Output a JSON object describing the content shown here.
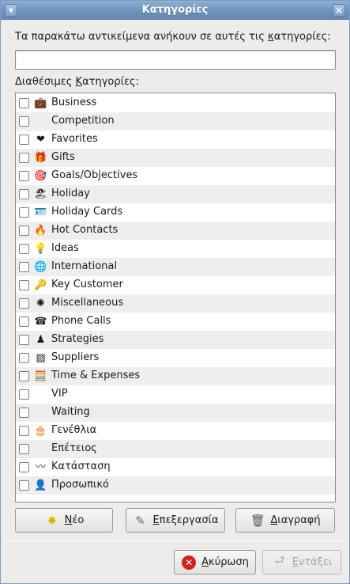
{
  "window": {
    "title": "Κατηγορίες"
  },
  "prompt": {
    "prefix": "Τα παρακάτω αντικείμενα ανήκουν σε αυτές τις ",
    "underlined": "κ",
    "suffix": "ατηγορίες:"
  },
  "entry": {
    "value": ""
  },
  "available": {
    "prefix": "Διαθέσιμες ",
    "underlined": "Κ",
    "suffix": "ατηγορίες:"
  },
  "categories": [
    {
      "label": "Business",
      "icon": "briefcase-icon",
      "glyph": "💼",
      "checked": false
    },
    {
      "label": "Competition",
      "icon": "",
      "glyph": "",
      "checked": false
    },
    {
      "label": "Favorites",
      "icon": "heart-icon",
      "glyph": "❤",
      "checked": false
    },
    {
      "label": "Gifts",
      "icon": "gift-icon",
      "glyph": "🎁",
      "checked": false
    },
    {
      "label": "Goals/Objectives",
      "icon": "target-icon",
      "glyph": "🎯",
      "checked": false
    },
    {
      "label": "Holiday",
      "icon": "holiday-icon",
      "glyph": "🏖",
      "checked": false
    },
    {
      "label": "Holiday Cards",
      "icon": "card-icon",
      "glyph": "🪪",
      "checked": false
    },
    {
      "label": "Hot Contacts",
      "icon": "flame-icon",
      "glyph": "🔥",
      "checked": false
    },
    {
      "label": "Ideas",
      "icon": "lightbulb-icon",
      "glyph": "💡",
      "checked": false
    },
    {
      "label": "International",
      "icon": "globe-icon",
      "glyph": "🌐",
      "checked": false
    },
    {
      "label": "Key Customer",
      "icon": "key-icon",
      "glyph": "🔑",
      "checked": false
    },
    {
      "label": "Miscellaneous",
      "icon": "sun-icon",
      "glyph": "✺",
      "checked": false
    },
    {
      "label": "Phone Calls",
      "icon": "telephone-icon",
      "glyph": "☎",
      "checked": false
    },
    {
      "label": "Strategies",
      "icon": "chess-piece-icon",
      "glyph": "♟",
      "checked": false
    },
    {
      "label": "Suppliers",
      "icon": "crate-icon",
      "glyph": "▨",
      "checked": false
    },
    {
      "label": "Time & Expenses",
      "icon": "calculator-icon",
      "glyph": "🧮",
      "checked": false
    },
    {
      "label": "VIP",
      "icon": "",
      "glyph": "",
      "checked": false
    },
    {
      "label": "Waiting",
      "icon": "",
      "glyph": "",
      "checked": false
    },
    {
      "label": "Γενέθλια",
      "icon": "cake-icon",
      "glyph": "🎂",
      "checked": false
    },
    {
      "label": "Επέτειος",
      "icon": "",
      "glyph": "",
      "checked": false
    },
    {
      "label": "Κατάσταση",
      "icon": "pulse-icon",
      "glyph": "〰",
      "checked": false
    },
    {
      "label": "Προσωπικό",
      "icon": "person-icon",
      "glyph": "👤",
      "checked": false
    }
  ],
  "buttons": {
    "new": {
      "underlined": "Ν",
      "rest": "έο"
    },
    "edit": {
      "underlined": "Ε",
      "rest": "πεξεργασία"
    },
    "delete": {
      "underlined": "Δ",
      "rest": "ιαγραφή"
    },
    "cancel": {
      "underlined": "Α",
      "rest": "κύρωση"
    },
    "ok": {
      "underlined": "Ε",
      "rest": "ντάξει"
    }
  },
  "colors": {
    "titlebar": "#7396bf",
    "row_alt": "#eeeeee",
    "window_bg": "#edeceb"
  }
}
